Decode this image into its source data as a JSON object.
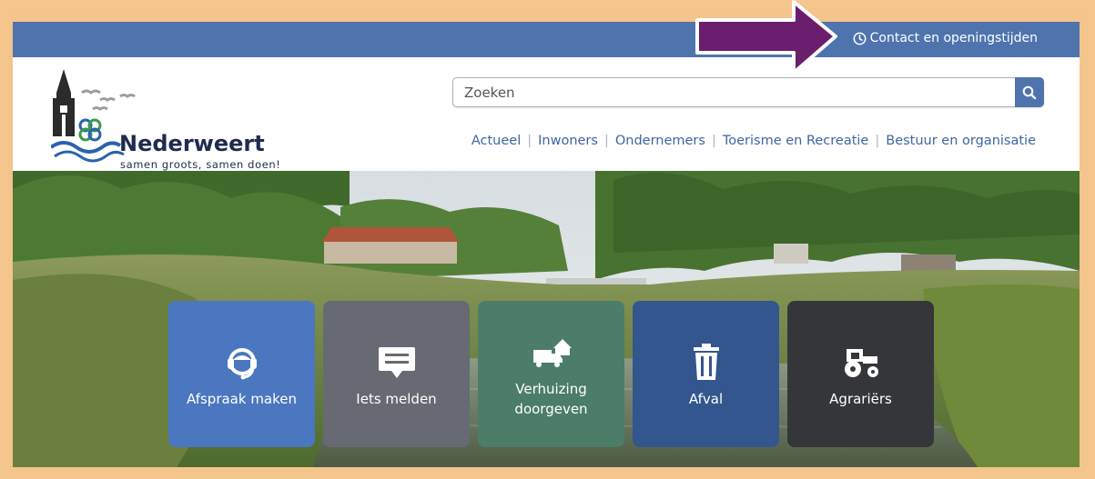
{
  "topbar": {
    "contact_label": "Contact en openingstijden"
  },
  "logo": {
    "name": "Nederweert",
    "tagline": "samen groots, samen doen!"
  },
  "search": {
    "placeholder": "Zoeken"
  },
  "nav": {
    "items": [
      "Actueel",
      "Inwoners",
      "Ondernemers",
      "Toerisme en Recreatie",
      "Bestuur en organisatie"
    ]
  },
  "tiles": [
    {
      "label": "Afspraak maken",
      "icon": "headset-icon",
      "color": "#4a77bf"
    },
    {
      "label": "Iets melden",
      "icon": "chat-icon",
      "color": "#676a72"
    },
    {
      "label_line1": "Verhuizing",
      "label_line2": "doorgeven",
      "icon": "moving-truck-icon",
      "color": "#4b7d68"
    },
    {
      "label": "Afval",
      "icon": "trash-icon",
      "color": "#32568d"
    },
    {
      "label": "Agrariërs",
      "icon": "tractor-icon",
      "color": "#35363a"
    }
  ],
  "colors": {
    "brand": "#4f74ad",
    "frame": "#f3c48c",
    "arrow": "#6b1e6e"
  }
}
